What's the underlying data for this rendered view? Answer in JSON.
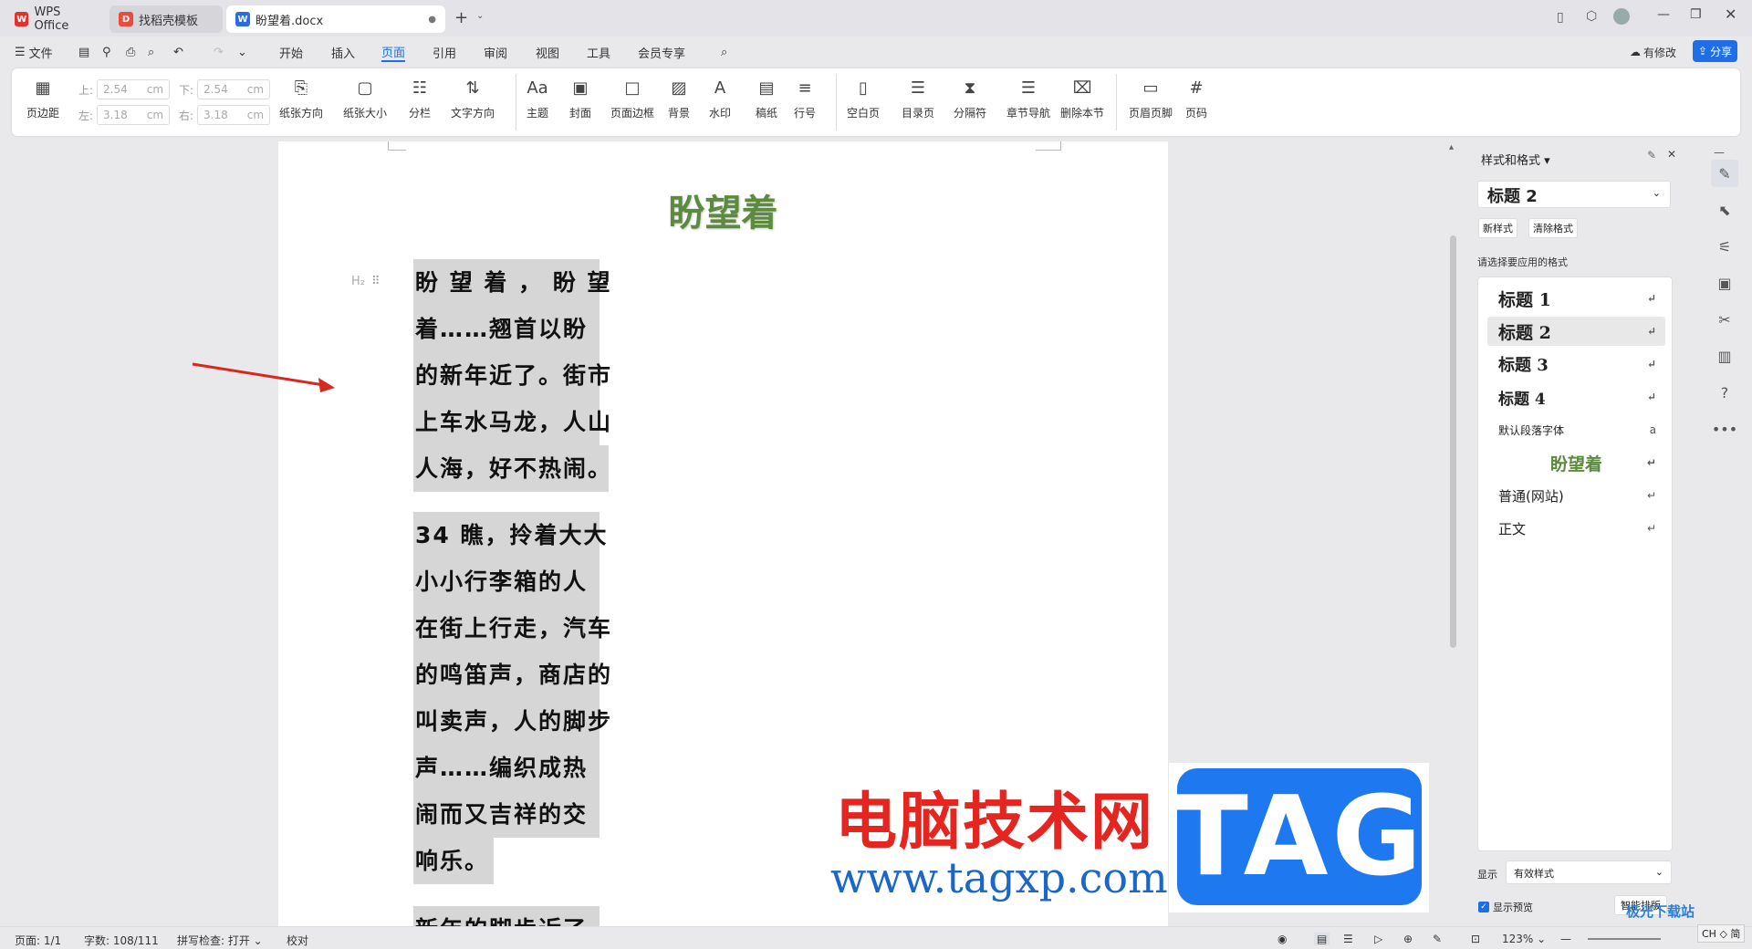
{
  "tabs": [
    {
      "label": "WPS Office",
      "icon": "wps-logo-icon"
    },
    {
      "label": "找稻壳模板",
      "icon": "docer-icon"
    },
    {
      "label": "盼望着.docx",
      "icon": "word-doc-icon"
    }
  ],
  "menu": {
    "file": "文件",
    "items": [
      "开始",
      "插入",
      "页面",
      "引用",
      "审阅",
      "视图",
      "工具",
      "会员专享"
    ],
    "active": "页面",
    "has_changes": "有修改",
    "share": "分享"
  },
  "ribbon": {
    "margins_label": "页边距",
    "top_label": "上:",
    "top_value": "2.54",
    "top_unit": "cm",
    "bottom_label": "下:",
    "bottom_value": "2.54",
    "bottom_unit": "cm",
    "left_label": "左:",
    "left_value": "3.18",
    "left_unit": "cm",
    "right_label": "右:",
    "right_value": "3.18",
    "right_unit": "cm",
    "buttons": [
      "纸张方向",
      "纸张大小",
      "分栏",
      "文字方向",
      "主题",
      "封面",
      "页面边框",
      "背景",
      "水印",
      "稿纸",
      "行号",
      "空白页",
      "目录页",
      "分隔符",
      "章节导航",
      "删除本节",
      "页眉页脚",
      "页码"
    ]
  },
  "document": {
    "title": "盼望着",
    "heading_marker": "H₂",
    "para1": [
      "盼 望 着 ， 盼 望",
      "着……翘首以盼",
      "的新年近了。街市",
      "上车水马龙，人山",
      "人海，好不热闹。"
    ],
    "para2": [
      "34 瞧，拎着大大",
      "小小行李箱的人",
      "在街上行走，汽车",
      "的鸣笛声，商店的",
      "叫卖声，人的脚步",
      "声……编织成热",
      "闹而又吉祥的交",
      "响乐。"
    ],
    "para3": [
      "新年的脚步近了"
    ]
  },
  "style_panel": {
    "title": "样式和格式",
    "current_style": "标题  2",
    "new_style": "新样式",
    "clear_format": "清除格式",
    "prompt": "请选择要应用的格式",
    "styles": [
      "标题  1",
      "标题  2",
      "标题  3",
      "标题  4",
      "默认段落字体",
      "盼望着",
      "普通(网站)",
      "正文"
    ],
    "show_label": "显示",
    "show_value": "有效样式",
    "preview_label": "显示预览",
    "smart_layout": "智能排版"
  },
  "status": {
    "page": "页面: 1/1",
    "words": "字数: 108/111",
    "spell": "拼写检查: 打开",
    "proof": "校对",
    "zoom": "123%"
  },
  "watermark": {
    "site_cn": "电脑技术网",
    "site_url": "www.tagxp.com",
    "tag": "TAG",
    "corner": "极光下载站",
    "ime": "CH ◇ 简"
  },
  "colors": {
    "accent": "#1e6fe6",
    "title_green": "#5c8a3e",
    "selection": "#d6d6d6"
  }
}
